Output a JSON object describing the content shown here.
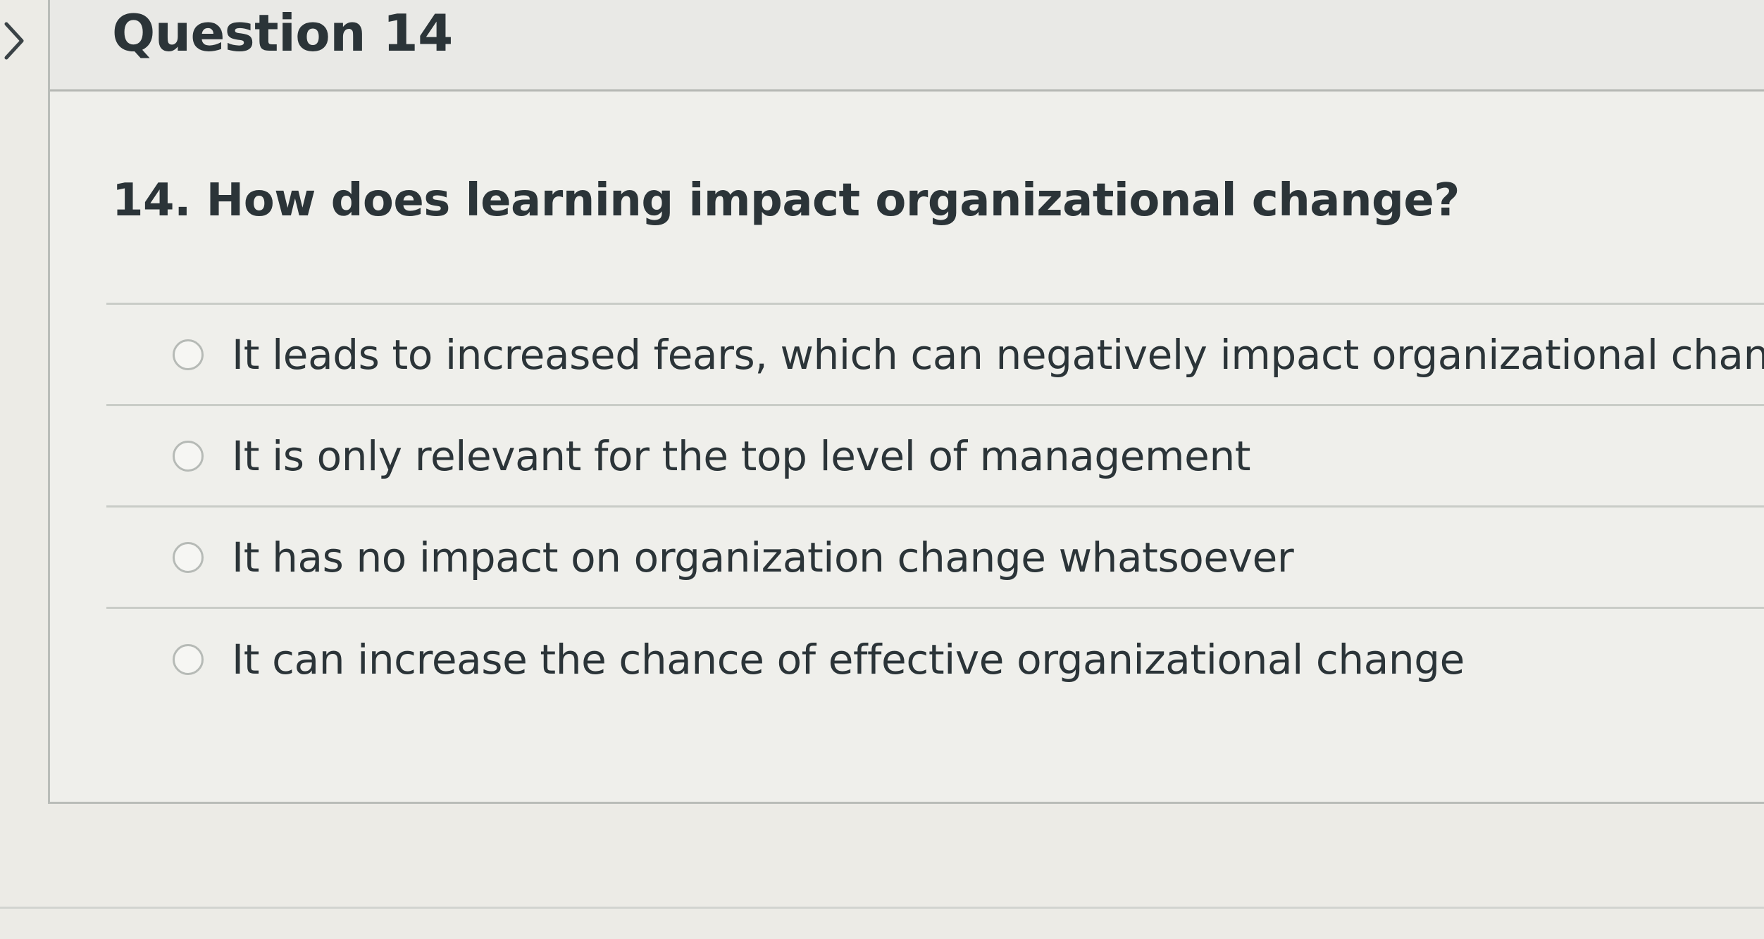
{
  "header": {
    "title": "Question 14"
  },
  "question": {
    "text": "14. How does learning impact organizational change?"
  },
  "answers": [
    {
      "label": "It leads to increased fears, which can negatively impact organizational change",
      "selected": false
    },
    {
      "label": "It is only relevant for the top level of management",
      "selected": false
    },
    {
      "label": "It has no impact on organization change whatsoever",
      "selected": false
    },
    {
      "label": "It can increase the chance of effective organizational change",
      "selected": false
    }
  ],
  "icons": {
    "nav": "chevron-right-icon",
    "option": "radio-button-icon"
  },
  "colors": {
    "text": "#2b3438",
    "background": "#ecebe6",
    "border": "#c9ccc7"
  }
}
